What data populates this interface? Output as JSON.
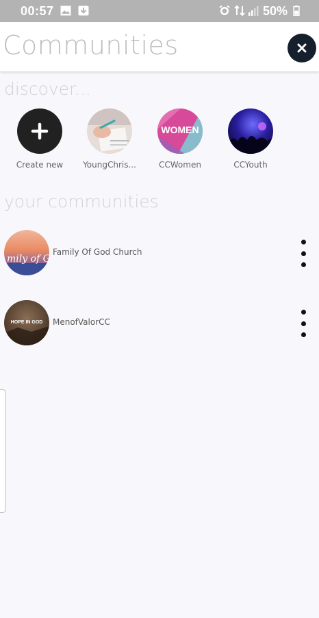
{
  "status_bar": {
    "time": "00:57",
    "battery_percent": "50%",
    "icons": [
      "image-icon",
      "download-icon",
      "alarm-icon",
      "data-4g-icon",
      "signal-icon",
      "battery-icon"
    ]
  },
  "header": {
    "title": "Communities",
    "close_icon": "close-icon"
  },
  "discover": {
    "label": "discover...",
    "items": [
      {
        "label": "Create new",
        "icon": "plus-icon"
      },
      {
        "label": "YoungChris...",
        "image": "writing-photo"
      },
      {
        "label": "CCWomen",
        "image": "women-logo"
      },
      {
        "label": "CCYouth",
        "image": "concert-photo"
      }
    ],
    "women_logo_text": "WOMEN"
  },
  "your_communities": {
    "label": "your communities",
    "items": [
      {
        "name": "Family Of God Church",
        "avatar_text": "mily of G",
        "menu_icon": "more-vertical-icon"
      },
      {
        "name": "MenofValorCC",
        "avatar_text": "HOPE IN GOD",
        "menu_icon": "more-vertical-icon"
      }
    ]
  },
  "colors": {
    "status_bar": "#b3b3b3",
    "background": "#f8f8fc",
    "close_button": "#16202d",
    "section_label": "#d2d2d2"
  }
}
